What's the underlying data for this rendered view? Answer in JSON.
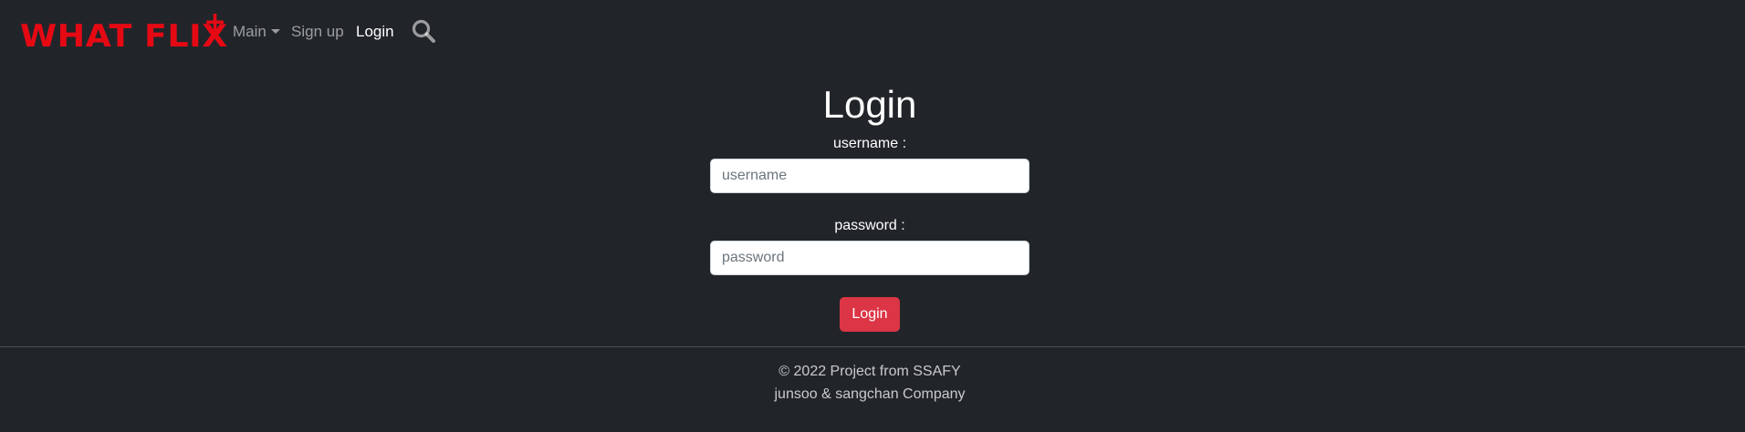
{
  "navbar": {
    "brand": {
      "text": "WHAT FLIX",
      "superscript": "+",
      "color": "#e50914"
    },
    "items": [
      {
        "label": "Main",
        "has_dropdown": true,
        "active": false
      },
      {
        "label": "Sign up",
        "active": false
      },
      {
        "label": "Login",
        "active": true
      }
    ],
    "search_icon": "search-icon"
  },
  "login_form": {
    "title": "Login",
    "username": {
      "label": "username :",
      "value": "",
      "placeholder": "username"
    },
    "password": {
      "label": "password :",
      "value": "",
      "placeholder": "password"
    },
    "submit_label": "Login",
    "submit_color": "#dc3545"
  },
  "footer": {
    "line1": "© 2022 Project from SSAFY",
    "line2": "junsoo & sangchan Company"
  },
  "colors": {
    "background": "#212529",
    "brand": "#e50914",
    "button": "#dc3545"
  }
}
